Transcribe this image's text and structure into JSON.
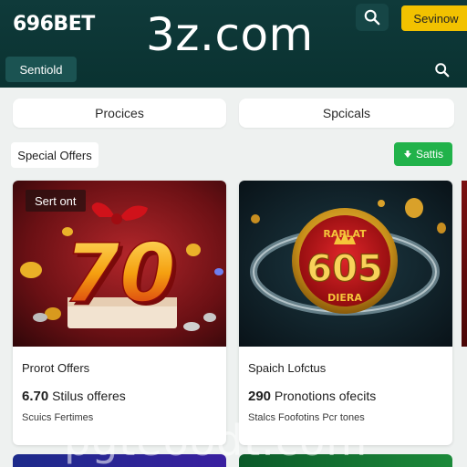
{
  "header": {
    "logo": "696BET",
    "watermark": "3z.com",
    "action_button": "Sevinow",
    "tab_label": "Sentiold",
    "icons": [
      "search-icon",
      "search-icon"
    ]
  },
  "segments": [
    "Procices",
    "Spcicals"
  ],
  "section": {
    "title": "Special Offers",
    "filter_label": "Sattis",
    "filter_icon": "arrow-down-icon"
  },
  "cards": [
    {
      "badge": "Sert ont",
      "image_text": "70",
      "title": "Prorot Offers",
      "value": "6.70",
      "value_text": "Stilus offeres",
      "subtitle": "Scuics Fertimes"
    },
    {
      "badge": "",
      "image_text": "605",
      "image_top_text": "RAPLAT",
      "image_bottom_text": "DIERA",
      "title": "Spaich Lofctus",
      "value": "290",
      "value_text": "Pronotions ofecits",
      "subtitle": "Stalcs  Foofotins Pcr tones"
    }
  ],
  "bottom_watermark": "pgteoodt.com",
  "colors": {
    "header_bg": "#0f3a3a",
    "accent_yellow": "#f2c200",
    "filter_green": "#21b24a",
    "page_bg": "#eef1f0"
  }
}
